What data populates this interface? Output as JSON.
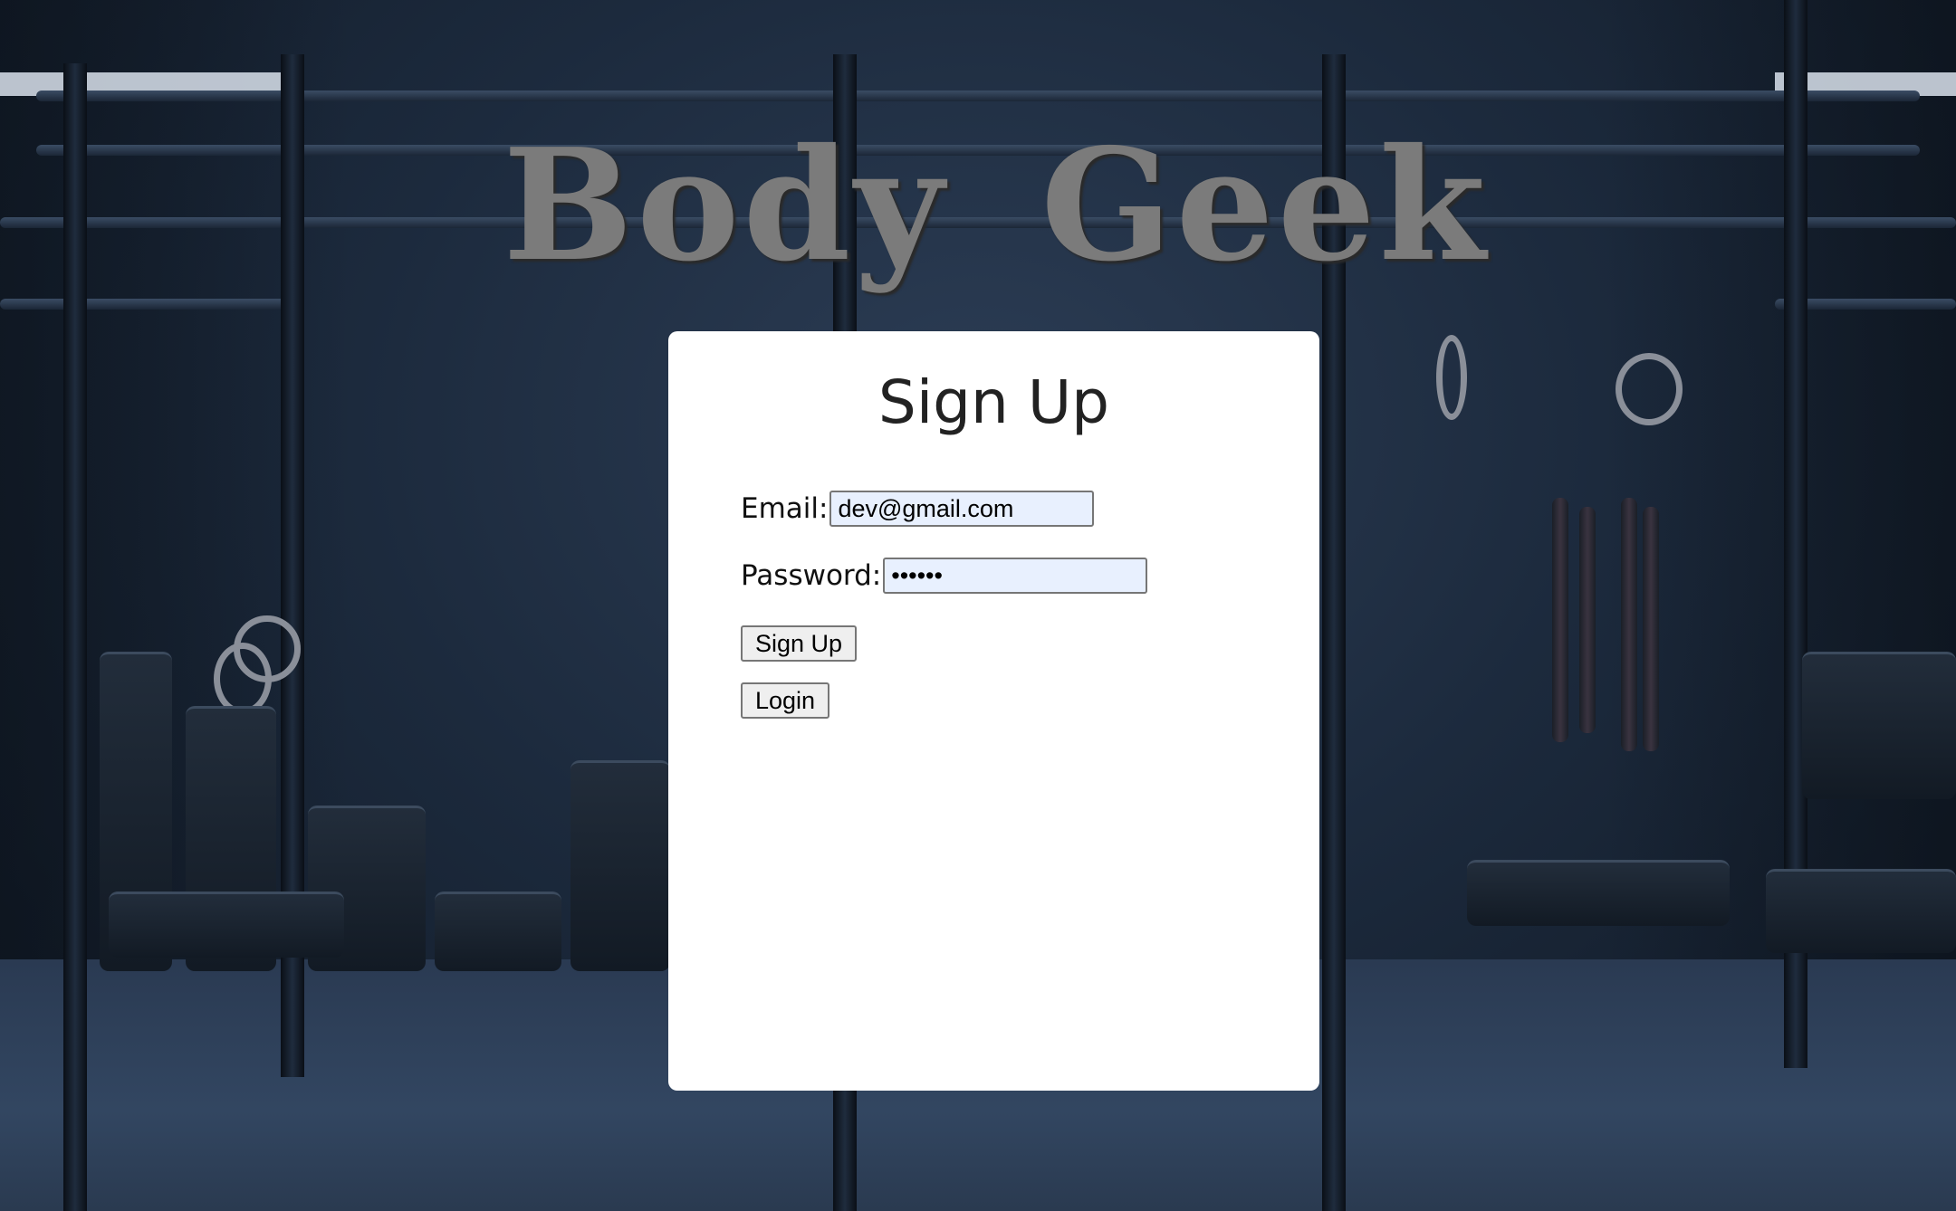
{
  "brand": {
    "title": "Body Geek"
  },
  "signup_form": {
    "heading": "Sign Up",
    "email_label": "Email:",
    "email_value": "dev@gmail.com",
    "password_label": "Password:",
    "password_value": "••••••",
    "signup_button": "Sign Up",
    "login_button": "Login"
  },
  "background": {
    "description_icon": "gym-background-image"
  },
  "colors": {
    "card_background": "#ffffff",
    "title_color": "#7b7b7b",
    "input_autofill": "#e8f0fe"
  }
}
